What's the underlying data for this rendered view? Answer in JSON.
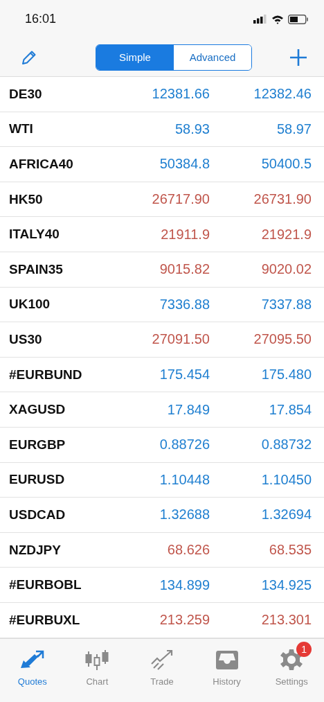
{
  "status_bar": {
    "time": "16:01"
  },
  "segments": [
    {
      "label": "Simple",
      "selected": true
    },
    {
      "label": "Advanced",
      "selected": false
    }
  ],
  "quotes": [
    {
      "symbol": "DE30",
      "bid": "12381.66",
      "ask": "12382.46",
      "color": "#1f7fd0"
    },
    {
      "symbol": "WTI",
      "bid": "58.93",
      "ask": "58.97",
      "color": "#1f7fd0"
    },
    {
      "symbol": "AFRICA40",
      "bid": "50384.8",
      "ask": "50400.5",
      "color": "#1f7fd0"
    },
    {
      "symbol": "HK50",
      "bid": "26717.90",
      "ask": "26731.90",
      "color": "#c0564c"
    },
    {
      "symbol": "ITALY40",
      "bid": "21911.9",
      "ask": "21921.9",
      "color": "#c0564c"
    },
    {
      "symbol": "SPAIN35",
      "bid": "9015.82",
      "ask": "9020.02",
      "color": "#c0564c"
    },
    {
      "symbol": "UK100",
      "bid": "7336.88",
      "ask": "7337.88",
      "color": "#1f7fd0"
    },
    {
      "symbol": "US30",
      "bid": "27091.50",
      "ask": "27095.50",
      "color": "#c0564c"
    },
    {
      "symbol": "#EURBUND",
      "bid": "175.454",
      "ask": "175.480",
      "color": "#1f7fd0"
    },
    {
      "symbol": "XAGUSD",
      "bid": "17.849",
      "ask": "17.854",
      "color": "#1f7fd0"
    },
    {
      "symbol": "EURGBP",
      "bid": "0.88726",
      "ask": "0.88732",
      "color": "#1f7fd0"
    },
    {
      "symbol": "EURUSD",
      "bid": "1.10448",
      "ask": "1.10450",
      "color": "#1f7fd0"
    },
    {
      "symbol": "USDCAD",
      "bid": "1.32688",
      "ask": "1.32694",
      "color": "#1f7fd0"
    },
    {
      "symbol": "NZDJPY",
      "bid": "68.626",
      "ask": "68.535",
      "color": "#c0564c"
    },
    {
      "symbol": "#EURBOBL",
      "bid": "134.899",
      "ask": "134.925",
      "color": "#1f7fd0"
    },
    {
      "symbol": "#EURBUXL",
      "bid": "213.259",
      "ask": "213.301",
      "color": "#c0564c"
    }
  ],
  "tab_bar": [
    {
      "label": "Quotes",
      "kind": "quotes",
      "selected": true
    },
    {
      "label": "Chart",
      "kind": "chart",
      "selected": false
    },
    {
      "label": "Trade",
      "kind": "trade",
      "selected": false
    },
    {
      "label": "History",
      "kind": "history",
      "selected": false
    },
    {
      "label": "Settings",
      "kind": "settings",
      "selected": false,
      "badge": "1"
    }
  ]
}
